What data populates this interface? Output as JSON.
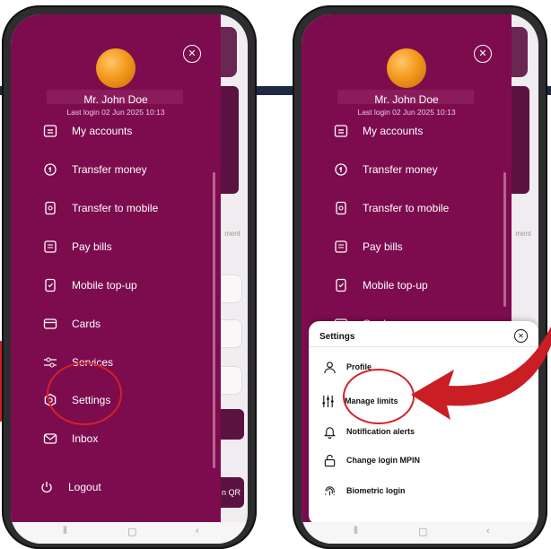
{
  "left_phone": {
    "user_name": "Mr. John Doe",
    "last_login": "Last login 02 Jun 2025 10:13",
    "menu": [
      {
        "label": "My accounts",
        "icon": "accounts-icon"
      },
      {
        "label": "Transfer money",
        "icon": "transfer-money-icon"
      },
      {
        "label": "Transfer to mobile",
        "icon": "transfer-mobile-icon"
      },
      {
        "label": "Pay bills",
        "icon": "bills-icon"
      },
      {
        "label": "Mobile top-up",
        "icon": "mobile-topup-icon"
      },
      {
        "label": "Cards",
        "icon": "card-icon"
      },
      {
        "label": "Services",
        "icon": "services-icon"
      },
      {
        "label": "Settings",
        "icon": "settings-icon"
      },
      {
        "label": "Inbox",
        "icon": "inbox-icon"
      },
      {
        "label": "Logout",
        "icon": "logout-icon"
      }
    ],
    "bg_texts": {
      "ment": "ment",
      "qr": "n QR"
    }
  },
  "right_phone": {
    "user_name": "Mr. John Doe",
    "last_login": "Last login 02 Jun 2025 10:13",
    "menu": [
      {
        "label": "My accounts"
      },
      {
        "label": "Transfer money"
      },
      {
        "label": "Transfer to mobile"
      },
      {
        "label": "Pay bills"
      },
      {
        "label": "Mobile top-up"
      },
      {
        "label": "Cards"
      }
    ],
    "sheet": {
      "title": "Settings",
      "items": [
        {
          "label": "Profile",
          "icon": "profile-icon"
        },
        {
          "label": "Manage limits",
          "icon": "sliders-icon"
        },
        {
          "label": "Notification alerts",
          "icon": "bell-icon"
        },
        {
          "label": "Change login MPIN",
          "icon": "lock-icon"
        },
        {
          "label": "Biometric login",
          "icon": "fingerprint-icon"
        }
      ]
    },
    "bg_texts": {
      "ment": "ment"
    }
  },
  "colors": {
    "brand": "#7d0c4e",
    "annotation": "#d3222a"
  }
}
